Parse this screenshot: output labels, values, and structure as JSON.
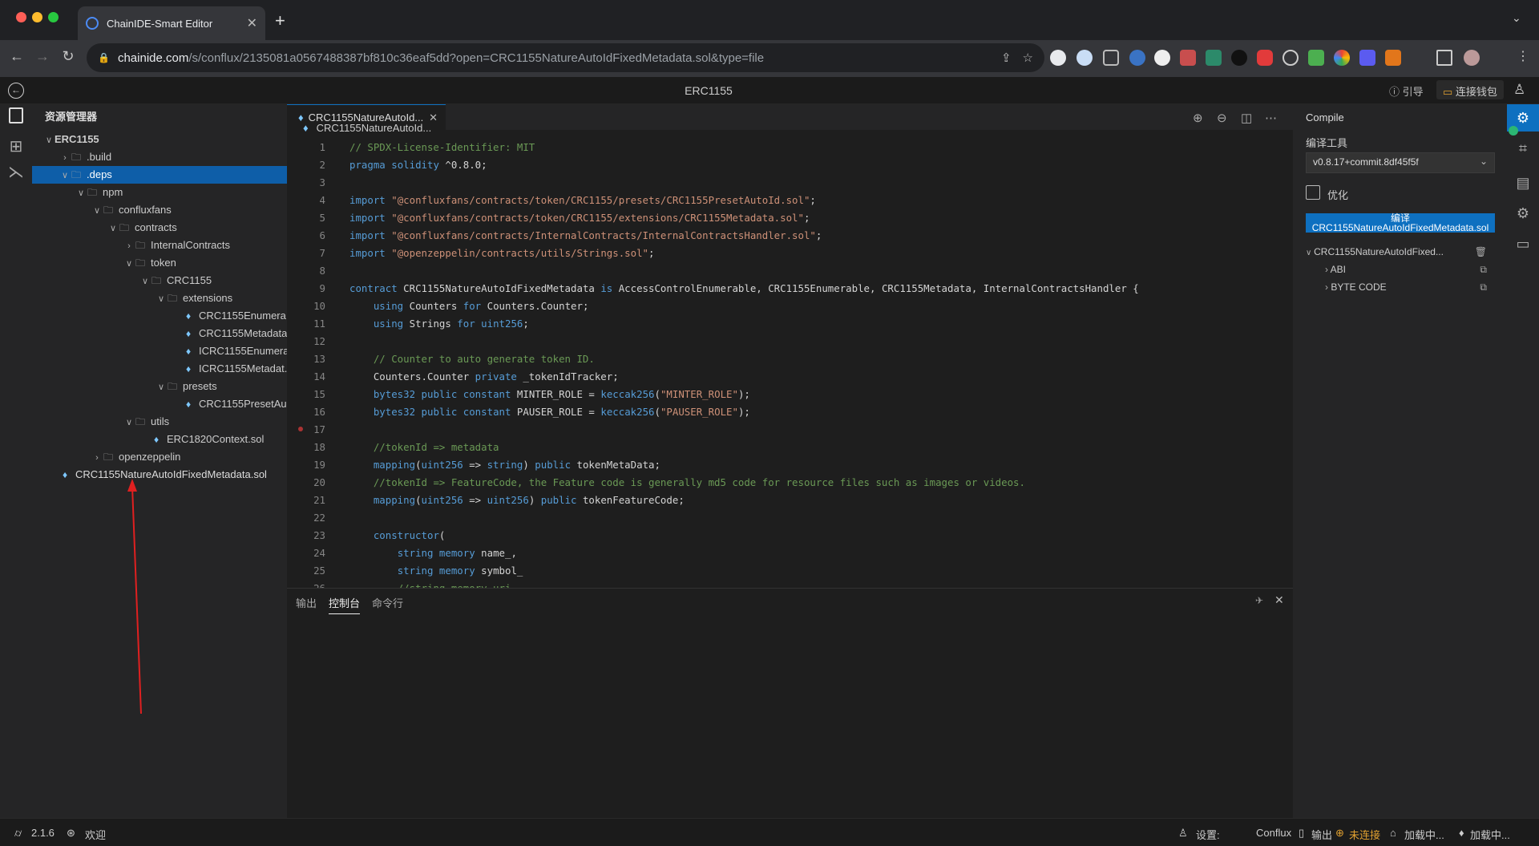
{
  "browser": {
    "tab_title": "ChainIDE-Smart Editor",
    "url_host": "chainide.com",
    "url_path": "/s/conflux/2135081a0567488387bf810c36eaf5dd?open=CRC1155NatureAutoIdFixedMetadata.sol&type=file"
  },
  "app": {
    "title": "ERC1155",
    "guide_label": "引导",
    "wallet_label": "连接钱包"
  },
  "explorer": {
    "header": "资源管理器",
    "items": [
      {
        "label": "ERC1155",
        "depth": 0,
        "kind": "root",
        "open": true
      },
      {
        "label": ".build",
        "depth": 1,
        "kind": "folder",
        "open": false
      },
      {
        "label": ".deps",
        "depth": 1,
        "kind": "folder",
        "open": true,
        "selected": true
      },
      {
        "label": "npm",
        "depth": 2,
        "kind": "folder",
        "open": true
      },
      {
        "label": "confluxfans",
        "depth": 3,
        "kind": "folder",
        "open": true
      },
      {
        "label": "contracts",
        "depth": 4,
        "kind": "folder",
        "open": true
      },
      {
        "label": "InternalContracts",
        "depth": 5,
        "kind": "folder",
        "open": false
      },
      {
        "label": "token",
        "depth": 5,
        "kind": "folder",
        "open": true
      },
      {
        "label": "CRC1155",
        "depth": 6,
        "kind": "folder",
        "open": true
      },
      {
        "label": "extensions",
        "depth": 7,
        "kind": "folder",
        "open": true
      },
      {
        "label": "CRC1155Enumera...",
        "depth": 8,
        "kind": "file"
      },
      {
        "label": "CRC1155Metadata...",
        "depth": 8,
        "kind": "file"
      },
      {
        "label": "ICRC1155Enumera...",
        "depth": 8,
        "kind": "file"
      },
      {
        "label": "ICRC1155Metadat...",
        "depth": 8,
        "kind": "file"
      },
      {
        "label": "presets",
        "depth": 7,
        "kind": "folder",
        "open": true
      },
      {
        "label": "CRC1155PresetAu...",
        "depth": 8,
        "kind": "file"
      },
      {
        "label": "utils",
        "depth": 5,
        "kind": "folder",
        "open": true
      },
      {
        "label": "ERC1820Context.sol",
        "depth": 6,
        "kind": "file"
      },
      {
        "label": "openzeppelin",
        "depth": 3,
        "kind": "folder",
        "open": false
      },
      {
        "label": "CRC1155NatureAutoIdFixedMetadata.sol",
        "depth": 1,
        "kind": "file",
        "active": true
      }
    ]
  },
  "editor": {
    "tab_label": "CRC1155NatureAutoId...",
    "breadcrumb": "CRC1155NatureAutoId...",
    "lines": [
      [
        [
          "cm",
          "// SPDX-License-Identifier: MIT"
        ]
      ],
      [
        [
          "kw",
          "pragma"
        ],
        [
          "tx",
          " "
        ],
        [
          "kw",
          "solidity"
        ],
        [
          "tx",
          " ^0.8.0;"
        ]
      ],
      [],
      [
        [
          "kw",
          "import"
        ],
        [
          "tx",
          " "
        ],
        [
          "st",
          "\"@confluxfans/contracts/token/CRC1155/presets/CRC1155PresetAutoId.sol\""
        ],
        [
          "tx",
          ";"
        ]
      ],
      [
        [
          "kw",
          "import"
        ],
        [
          "tx",
          " "
        ],
        [
          "st",
          "\"@confluxfans/contracts/token/CRC1155/extensions/CRC1155Metadata.sol\""
        ],
        [
          "tx",
          ";"
        ]
      ],
      [
        [
          "kw",
          "import"
        ],
        [
          "tx",
          " "
        ],
        [
          "st",
          "\"@confluxfans/contracts/InternalContracts/InternalContractsHandler.sol\""
        ],
        [
          "tx",
          ";"
        ]
      ],
      [
        [
          "kw",
          "import"
        ],
        [
          "tx",
          " "
        ],
        [
          "st",
          "\"@openzeppelin/contracts/utils/Strings.sol\""
        ],
        [
          "tx",
          ";"
        ]
      ],
      [],
      [
        [
          "kw",
          "contract"
        ],
        [
          "tx",
          " CRC1155NatureAutoIdFixedMetadata "
        ],
        [
          "kw",
          "is"
        ],
        [
          "tx",
          " AccessControlEnumerable, CRC1155Enumerable, CRC1155Metadata, InternalContractsHandler {"
        ]
      ],
      [
        [
          "tx",
          "    "
        ],
        [
          "kw",
          "using"
        ],
        [
          "tx",
          " Counters "
        ],
        [
          "kw",
          "for"
        ],
        [
          "tx",
          " Counters.Counter;"
        ]
      ],
      [
        [
          "tx",
          "    "
        ],
        [
          "kw",
          "using"
        ],
        [
          "tx",
          " Strings "
        ],
        [
          "kw",
          "for"
        ],
        [
          "tx",
          " "
        ],
        [
          "kw",
          "uint256"
        ],
        [
          "tx",
          ";"
        ]
      ],
      [],
      [
        [
          "tx",
          "    "
        ],
        [
          "cm",
          "// Counter to auto generate token ID."
        ]
      ],
      [
        [
          "tx",
          "    Counters.Counter "
        ],
        [
          "kw",
          "private"
        ],
        [
          "tx",
          " _tokenIdTracker;"
        ]
      ],
      [
        [
          "tx",
          "    "
        ],
        [
          "kw",
          "bytes32"
        ],
        [
          "tx",
          " "
        ],
        [
          "kw",
          "public"
        ],
        [
          "tx",
          " "
        ],
        [
          "kw",
          "constant"
        ],
        [
          "tx",
          " MINTER_ROLE = "
        ],
        [
          "kw",
          "keccak256"
        ],
        [
          "tx",
          "("
        ],
        [
          "st",
          "\"MINTER_ROLE\""
        ],
        [
          "tx",
          ");"
        ]
      ],
      [
        [
          "tx",
          "    "
        ],
        [
          "kw",
          "bytes32"
        ],
        [
          "tx",
          " "
        ],
        [
          "kw",
          "public"
        ],
        [
          "tx",
          " "
        ],
        [
          "kw",
          "constant"
        ],
        [
          "tx",
          " PAUSER_ROLE = "
        ],
        [
          "kw",
          "keccak256"
        ],
        [
          "tx",
          "("
        ],
        [
          "st",
          "\"PAUSER_ROLE\""
        ],
        [
          "tx",
          ");"
        ]
      ],
      [],
      [
        [
          "tx",
          "    "
        ],
        [
          "cm",
          "//tokenId => metadata"
        ]
      ],
      [
        [
          "tx",
          "    "
        ],
        [
          "kw",
          "mapping"
        ],
        [
          "tx",
          "("
        ],
        [
          "kw",
          "uint256"
        ],
        [
          "tx",
          " => "
        ],
        [
          "kw",
          "string"
        ],
        [
          "tx",
          ") "
        ],
        [
          "kw",
          "public"
        ],
        [
          "tx",
          " tokenMetaData;"
        ]
      ],
      [
        [
          "tx",
          "    "
        ],
        [
          "cm",
          "//tokenId => FeatureCode, the Feature code is generally md5 code for resource files such as images or videos."
        ]
      ],
      [
        [
          "tx",
          "    "
        ],
        [
          "kw",
          "mapping"
        ],
        [
          "tx",
          "("
        ],
        [
          "kw",
          "uint256"
        ],
        [
          "tx",
          " => "
        ],
        [
          "kw",
          "uint256"
        ],
        [
          "tx",
          ") "
        ],
        [
          "kw",
          "public"
        ],
        [
          "tx",
          " tokenFeatureCode;"
        ]
      ],
      [],
      [
        [
          "tx",
          "    "
        ],
        [
          "kw",
          "constructor"
        ],
        [
          "tx",
          "("
        ]
      ],
      [
        [
          "tx",
          "        "
        ],
        [
          "kw",
          "string"
        ],
        [
          "tx",
          " "
        ],
        [
          "kw",
          "memory"
        ],
        [
          "tx",
          " name_,"
        ]
      ],
      [
        [
          "tx",
          "        "
        ],
        [
          "kw",
          "string"
        ],
        [
          "tx",
          " "
        ],
        [
          "kw",
          "memory"
        ],
        [
          "tx",
          " symbol_"
        ]
      ],
      [
        [
          "tx",
          "        "
        ],
        [
          "cm",
          "//string memory uri"
        ]
      ]
    ]
  },
  "panel": {
    "tabs": [
      "输出",
      "控制台",
      "命令行"
    ],
    "active": 1
  },
  "compile": {
    "title": "Compile",
    "tool_label": "编译工具",
    "version": "v0.8.17+commit.8df45f5f",
    "optimize_label": "优化",
    "compile_button_line1": "编译",
    "compile_button_line2": "CRC1155NatureAutoIdFixedMetadata.sol",
    "contract_name": "CRC1155NatureAutoIdFixed...",
    "abi_label": "ABI",
    "bytecode_label": "BYTE CODE"
  },
  "status": {
    "version": "2.1.6",
    "welcome": "欢迎",
    "settings": "设置:",
    "network": "Conflux",
    "output": "输出",
    "connection": "未连接",
    "loading1": "加载中...",
    "loading2": "加载中..."
  },
  "colors": {
    "accent": "#0e70c0",
    "selection": "#0e5ea8",
    "disconnected": "#e0a030",
    "annotation_arrow": "#e02020"
  }
}
